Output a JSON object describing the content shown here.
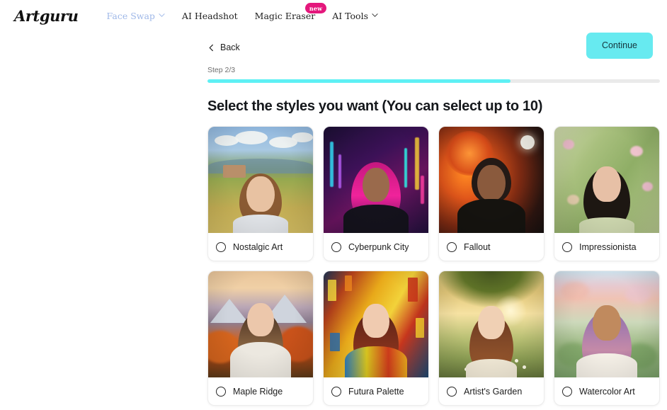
{
  "brand": {
    "name": "Artguru"
  },
  "nav": {
    "items": [
      {
        "label": "Face Swap",
        "active": true,
        "has_chevron": true,
        "badge": null
      },
      {
        "label": "AI Headshot",
        "active": false,
        "has_chevron": false,
        "badge": null
      },
      {
        "label": "Magic Eraser",
        "active": false,
        "has_chevron": false,
        "badge": "new"
      },
      {
        "label": "AI Tools",
        "active": false,
        "has_chevron": true,
        "badge": null
      }
    ]
  },
  "toolbar": {
    "back_label": "Back",
    "continue_label": "Continue"
  },
  "progress": {
    "step_label": "Step 2/3",
    "percent": 67
  },
  "main": {
    "heading": "Select the styles you want (You can select up to 10)",
    "max_selectable": 10,
    "styles": [
      {
        "label": "Nostalgic Art",
        "selected": false,
        "art": "t-nostalgic"
      },
      {
        "label": "Cyberpunk City",
        "selected": false,
        "art": "t-cyber"
      },
      {
        "label": "Fallout",
        "selected": false,
        "art": "t-fallout"
      },
      {
        "label": "Impressionista",
        "selected": false,
        "art": "t-impress"
      },
      {
        "label": "Maple Ridge",
        "selected": false,
        "art": "t-maple"
      },
      {
        "label": "Futura Palette",
        "selected": false,
        "art": "t-futura"
      },
      {
        "label": "Artist's Garden",
        "selected": false,
        "art": "t-garden"
      },
      {
        "label": "Watercolor Art",
        "selected": false,
        "art": "t-water"
      }
    ]
  },
  "colors": {
    "accent_cyan": "#67eaf0",
    "progress_fill": "#5ef0f4",
    "badge_pink": "#e4177c",
    "active_nav": "#9fb8e8",
    "track_gray": "#eaeaea"
  }
}
